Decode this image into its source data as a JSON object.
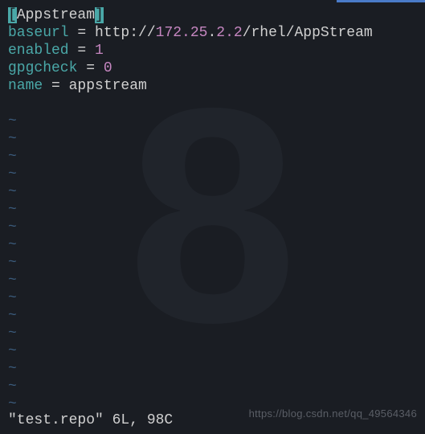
{
  "editor": {
    "section_open": "[",
    "section_name": "Appstream",
    "section_close": "]",
    "lines": [
      {
        "key": "baseurl",
        "eq": " = ",
        "prefix": "http://",
        "ip1": "172.25",
        "dot": ".",
        "ip2": "2.2",
        "suffix": "/rhel/AppStream"
      },
      {
        "key": "enabled",
        "eq": " = ",
        "num": "1"
      },
      {
        "key": "gpgcheck",
        "eq": " = ",
        "num": "0"
      },
      {
        "key": "name",
        "eq": " = ",
        "plain": "appstream"
      }
    ],
    "tilde": "~",
    "status": "\"test.repo\" 6L, 98C",
    "watermark": "https://blog.csdn.net/qq_49564346",
    "bg_glyph": "8"
  }
}
